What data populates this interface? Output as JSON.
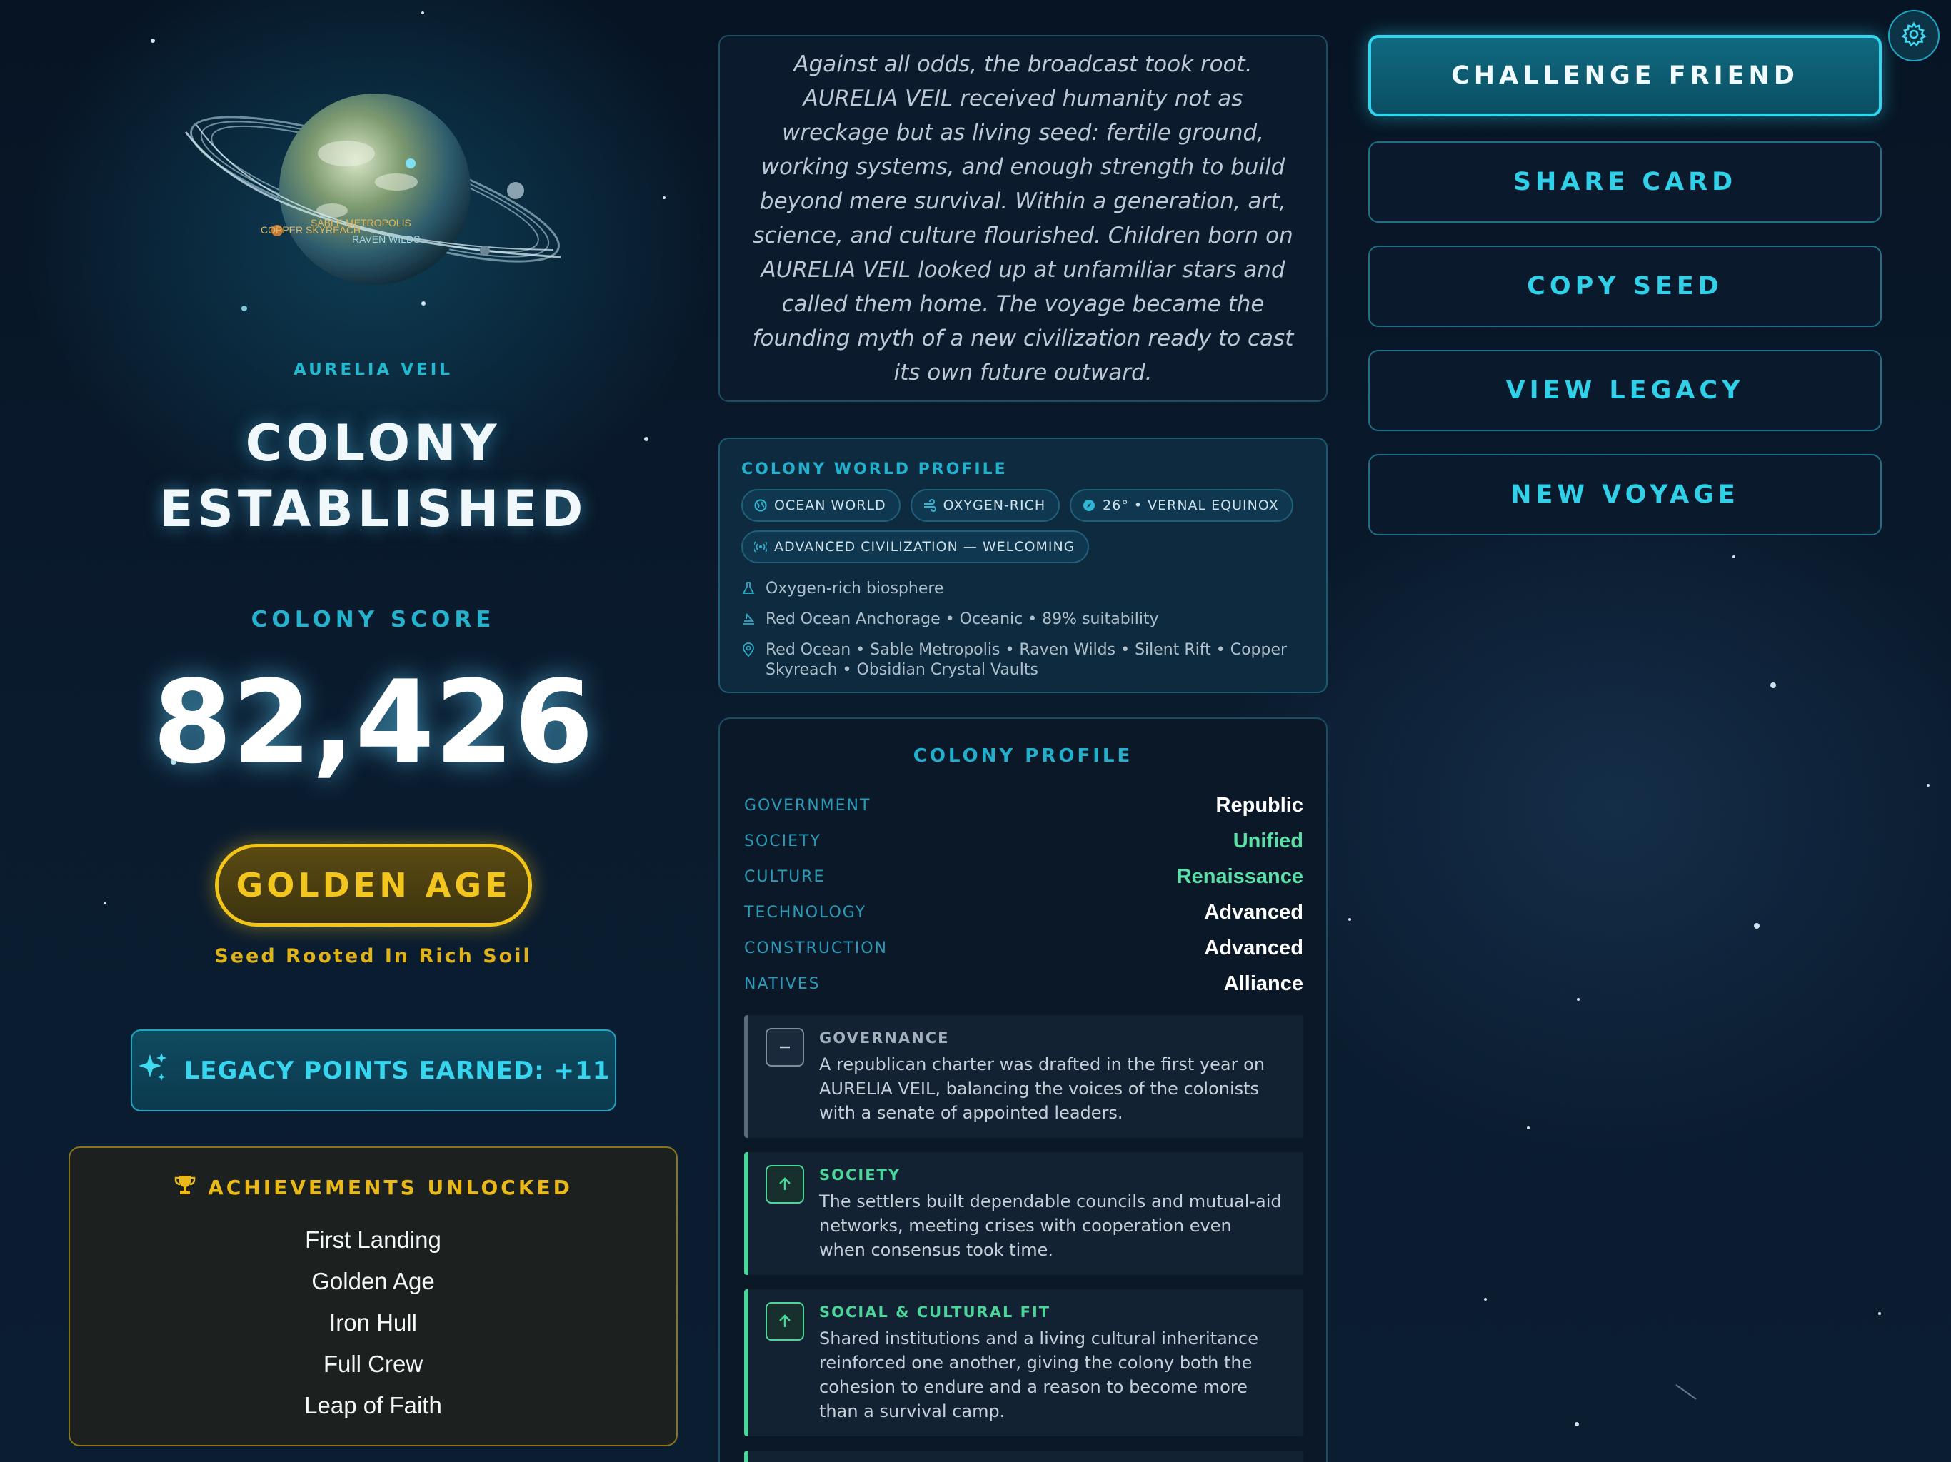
{
  "world": {
    "name": "AURELIA VEIL",
    "status": [
      "COLONY",
      "ESTABLISHED"
    ],
    "planet_labels": [
      "SABLE METROPOLIS",
      "COPPER SKYREACH",
      "RAVEN WILDS"
    ]
  },
  "score": {
    "label": "COLONY SCORE",
    "value": "82,426"
  },
  "era": {
    "label": "GOLDEN AGE",
    "subtitle": "Seed Rooted In Rich Soil"
  },
  "legacy": {
    "label": "LEGACY POINTS EARNED: +11",
    "icon": "sparkles-icon"
  },
  "achievements": {
    "title": "ACHIEVEMENTS UNLOCKED",
    "icon": "trophy-icon",
    "items": [
      "First Landing",
      "Golden Age",
      "Iron Hull",
      "Full Crew",
      "Leap of Faith"
    ]
  },
  "story": {
    "text": "Against all odds, the broadcast took root. AURELIA VEIL received humanity not as wreckage but as living seed: fertile ground, working systems, and enough strength to build beyond mere survival. Within a generation, art, science, and culture flourished. Children born on AURELIA VEIL looked up at unfamiliar stars and called them home. The voyage became the founding myth of a new civilization ready to cast its own future outward."
  },
  "world_profile": {
    "title": "COLONY WORLD PROFILE",
    "chips": [
      {
        "label": "OCEAN WORLD",
        "icon": "globe-icon"
      },
      {
        "label": "OXYGEN-RICH",
        "icon": "wind-icon"
      },
      {
        "label": "26° • VERNAL EQUINOX",
        "icon": "compass-icon"
      },
      {
        "label": "ADVANCED CIVILIZATION — WELCOMING",
        "icon": "signal-icon"
      }
    ],
    "lines": [
      {
        "text": "Oxygen-rich biosphere",
        "icon": "flask-icon"
      },
      {
        "text": "Red Ocean Anchorage • Oceanic • 89% suitability",
        "icon": "landing-icon"
      },
      {
        "text": "Red Ocean • Sable Metropolis • Raven Wilds • Silent Rift • Copper Skyreach • Obsidian Crystal Vaults",
        "icon": "map-pin-icon"
      }
    ]
  },
  "colony_profile": {
    "title": "COLONY PROFILE",
    "rows": [
      {
        "key": "GOVERNMENT",
        "value": "Republic",
        "tone": "neutral"
      },
      {
        "key": "SOCIETY",
        "value": "Unified",
        "tone": "good"
      },
      {
        "key": "CULTURE",
        "value": "Renaissance",
        "tone": "good"
      },
      {
        "key": "TECHNOLOGY",
        "value": "Advanced",
        "tone": "neutral"
      },
      {
        "key": "CONSTRUCTION",
        "value": "Advanced",
        "tone": "neutral"
      },
      {
        "key": "NATIVES",
        "value": "Alliance",
        "tone": "neutral"
      }
    ],
    "notes": [
      {
        "title": "GOVERNANCE",
        "icon": "minus-icon",
        "trend": "neutral",
        "body": "A republican charter was drafted in the first year on AURELIA VEIL, balancing the voices of the colonists with a senate of appointed leaders."
      },
      {
        "title": "SOCIETY",
        "icon": "arrow-up-icon",
        "trend": "up",
        "body": "The settlers built dependable councils and mutual-aid networks, meeting crises with cooperation even when consensus took time."
      },
      {
        "title": "SOCIAL & CULTURAL FIT",
        "icon": "arrow-up-icon",
        "trend": "up",
        "body": "Shared institutions and a living cultural inheritance reinforced one another, giving the colony both the cohesion to endure and a reason to become more than a survival camp."
      }
    ]
  },
  "actions": {
    "challenge": "CHALLENGE FRIEND",
    "share": "SHARE CARD",
    "copy_seed": "COPY SEED",
    "view_legacy": "VIEW LEGACY",
    "new_voyage": "NEW VOYAGE",
    "settings_icon": "gear-icon"
  },
  "colors": {
    "accent": "#2fd0e8",
    "gold": "#f0c419",
    "positive": "#4cd69a",
    "background": "#0a1b2e"
  }
}
